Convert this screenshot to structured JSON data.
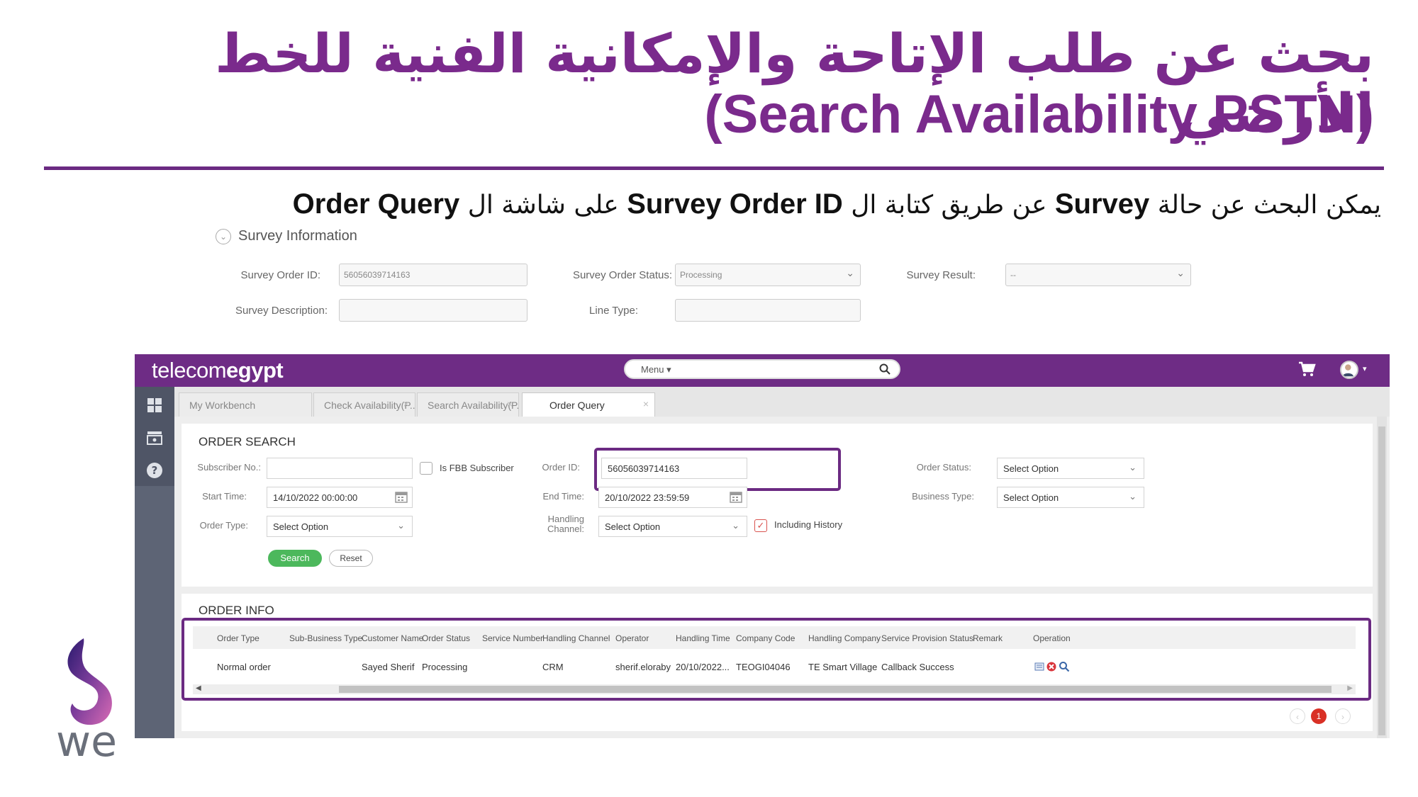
{
  "slide": {
    "title_ar": "بحث عن طلب الإتاحة والإمكانية الفنية للخط الأرضي",
    "title_en": "(Search Availability PSTN)",
    "desc": {
      "p1": "يمكن البحث عن حالة ",
      "p2": "Survey",
      "p3": " عن طريق كتابة ال ",
      "p4": "Survey Order ID",
      "p5": " على شاشة ال ",
      "p6": "Order Query"
    },
    "accent_color": "#6b2a82"
  },
  "survey_info": {
    "heading": "Survey Information",
    "order_id_label": "Survey Order ID:",
    "order_id_value": "56056039714163",
    "status_label": "Survey Order Status:",
    "status_value": "Processing",
    "result_label": "Survey Result:",
    "result_value": "--",
    "description_label": "Survey Description:",
    "description_value": "",
    "line_type_label": "Line Type:",
    "line_type_value": ""
  },
  "app": {
    "logo_light": "telecom",
    "logo_bold": "egypt",
    "menu_label": "Menu",
    "brand_color": "#6e2c85",
    "tabs": [
      {
        "label": "My Workbench"
      },
      {
        "label": "Check Availability(P..."
      },
      {
        "label": "Search Availability(P..."
      },
      {
        "label": "Order Query"
      }
    ],
    "order_search": {
      "title": "ORDER SEARCH",
      "subscriber_label": "Subscriber No.:",
      "subscriber_value": "",
      "fbb_label": "Is FBB Subscriber",
      "order_id_label": "Order ID:",
      "order_id_value": "56056039714163",
      "order_status_label": "Order Status:",
      "order_status_value": "Select Option",
      "start_label": "Start Time:",
      "start_value": "14/10/2022 00:00:00",
      "end_label": "End Time:",
      "end_value": "20/10/2022 23:59:59",
      "business_label": "Business Type:",
      "business_value": "Select Option",
      "order_type_label": "Order Type:",
      "order_type_value": "Select Option",
      "handling_label_1": "Handling",
      "handling_label_2": "Channel:",
      "handling_value": "Select Option",
      "history_label": "Including History",
      "search_btn": "Search",
      "reset_btn": "Reset"
    },
    "order_info": {
      "title": "ORDER INFO",
      "columns": [
        "Order Type",
        "Sub-Business Type",
        "Customer Name",
        "Order Status",
        "Service Number",
        "Handling Channel",
        "Operator",
        "Handling Time",
        "Company Code",
        "Handling Company",
        "Service Provision Status",
        "Remark",
        "Operation"
      ],
      "row": [
        "Normal order",
        "",
        "Sayed Sherif",
        "Processing",
        "",
        "CRM",
        "sherif.eloraby",
        "20/10/2022...",
        "TEOGI04046",
        "TE Smart Village",
        "Callback Success",
        "",
        ""
      ]
    },
    "pagination": {
      "current": "1"
    }
  },
  "brand": {
    "we_text": "we"
  }
}
